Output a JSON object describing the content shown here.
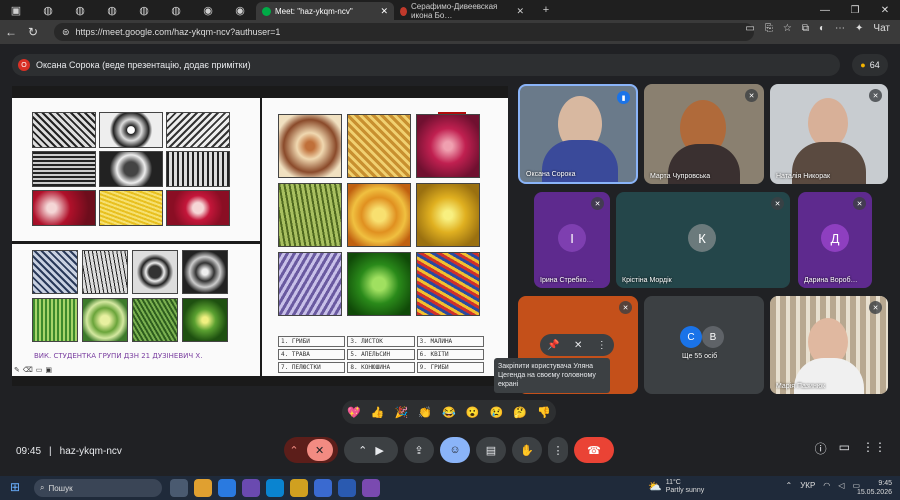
{
  "browser": {
    "tabs": [
      {
        "title": "Meet: \"haz-ykqm-ncv\"",
        "active": true
      },
      {
        "title": "Серафимо-Дивеевская икона Бо…",
        "active": false
      }
    ],
    "new_tab": "+",
    "url": "https://meet.google.com/haz-ykqm-ncv?authuser=1",
    "chat_label": "Чат"
  },
  "meet": {
    "presenter": {
      "initial": "О",
      "text": "Оксана Сорока (веде презентацію, додає примітки)"
    },
    "people_count": "64",
    "slide": {
      "labels": [
        "1. ГРИБИ",
        "3. ЛИСТОК",
        "3. МАЛИНА",
        "4. ТРАВА",
        "5. АПЕЛЬСИН",
        "6. КВІТИ",
        "7. ПЕЛЮСТКИ",
        "8. КОНЮШИНА",
        "9. ГРИБИ"
      ],
      "caption": "ВИК. СТУДЕНТКА ГРУПИ ДЗН 21 ДУЗІНЕВИЧ Х."
    },
    "tiles": [
      {
        "name": "Оксана Сорока",
        "mic": "active"
      },
      {
        "name": "Марта Чупровська",
        "mic": "muted"
      },
      {
        "name": "Наталія Никорак",
        "mic": "muted"
      },
      {
        "name": "Ірина Стребко…",
        "initial": "І",
        "mic": "muted"
      },
      {
        "name": "Крістіна Мордік",
        "initial": "К",
        "mic": "muted"
      },
      {
        "name": "Дарина Вороб…",
        "initial": "Д",
        "mic": "muted"
      },
      {
        "name": "",
        "mic": "muted"
      },
      {
        "name": "Ще 55 осіб",
        "initials": [
          "С",
          "В"
        ]
      },
      {
        "name": "Марія Пазинюк",
        "mic": "muted"
      }
    ],
    "tooltip": "Закріпити користувача Уляна Цегенда на своєму головному екрані",
    "reactions": [
      "💖",
      "👍",
      "🎉",
      "👏",
      "😂",
      "😮",
      "😢",
      "🤔",
      "👎"
    ],
    "time": "09:45",
    "meeting_code": "haz-ykqm-ncv"
  },
  "taskbar": {
    "search_placeholder": "Пошук",
    "weather_temp": "11°C",
    "weather_desc": "Partly sunny",
    "lang": "УКР",
    "time": "9:45",
    "date": "15.05.2026"
  },
  "colors": {
    "accent": "#8ab4f8",
    "end_call": "#ea4335",
    "tile_purple": "#5e2a8e",
    "tile_teal": "#24464a"
  }
}
